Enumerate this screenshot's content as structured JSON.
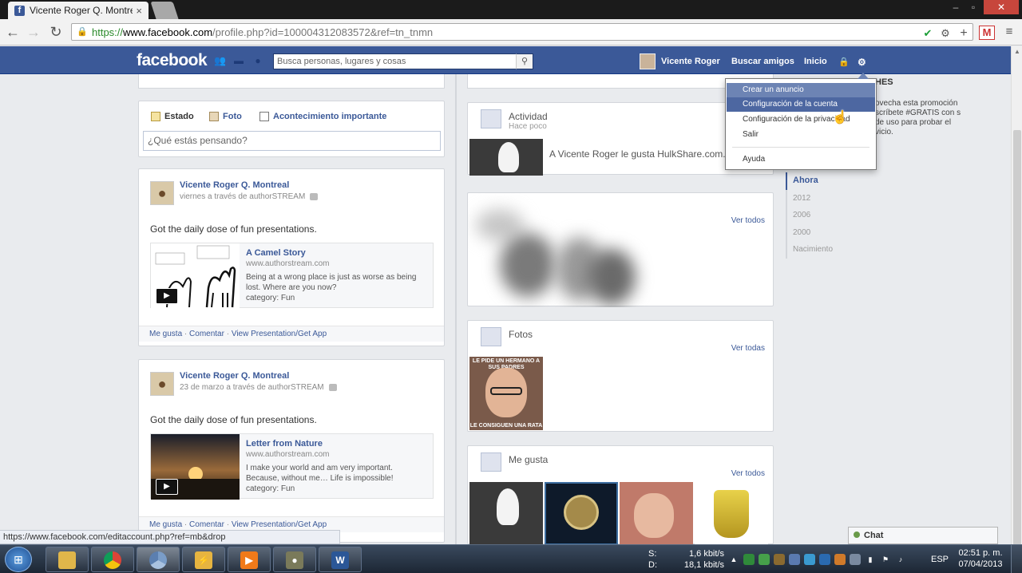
{
  "browser": {
    "tab_title": "Vicente Roger Q. Montrea",
    "url_scheme": "https://",
    "url_host": "www.facebook.com",
    "url_path": "/profile.php?id=100004312083572&ref=tn_tnmn",
    "status_url": "https://www.facebook.com/editaccount.php?ref=mb&drop"
  },
  "fbbar": {
    "logo": "facebook",
    "search_placeholder": "Busca personas, lugares y cosas",
    "profile_name": "Vicente Roger",
    "find_friends": "Buscar amigos",
    "home": "Inicio"
  },
  "composer": {
    "tab_status": "Estado",
    "tab_photo": "Foto",
    "tab_event": "Acontecimiento importante",
    "placeholder": "¿Qué estás pensando?"
  },
  "posts": [
    {
      "author": "Vicente Roger Q. Montreal",
      "meta": "viernes a través de authorSTREAM",
      "text": "Got the daily dose of fun presentations.",
      "share_title": "A Camel Story",
      "share_url": "www.authorstream.com",
      "share_desc": "Being at a wrong place is just as worse as being lost. Where are you now?",
      "share_category": "category: Fun",
      "like": "Me gusta",
      "comment": "Comentar",
      "app": "View Presentation/Get App"
    },
    {
      "author": "Vicente Roger Q. Montreal",
      "meta": "23 de marzo a través de authorSTREAM",
      "text": "Got the daily dose of fun presentations.",
      "share_title": "Letter from Nature",
      "share_url": "www.authorstream.com",
      "share_desc": "I make your world and am very important. Because, without me… Life is impossible!",
      "share_category": "category: Fun",
      "like": "Me gusta",
      "comment": "Comentar",
      "app": "View Presentation/Get App"
    }
  ],
  "activity": {
    "title": "Actividad",
    "subtitle": "Hace poco",
    "text_prefix": "A Vicente Roger le gusta ",
    "text_link": "HulkShare.com."
  },
  "friends_box": {
    "see_all": "Ver todos"
  },
  "photos": {
    "title": "Fotos",
    "see_all": "Ver todas",
    "caption_top": "LE PIDE UN HERMANO A SUS PADRES",
    "caption_bottom": "LE CONSIGUEN UNA RATA"
  },
  "likes": {
    "title": "Me gusta",
    "see_all": "Ver todos"
  },
  "sidebar": {
    "title": "HES",
    "text": "ovecha esta promoción scríbete #GRATIS con s de uso para probar el vicio.",
    "years": [
      "Ahora",
      "2012",
      "2006",
      "2000",
      "Nacimiento"
    ]
  },
  "dropdown": {
    "create_ad": "Crear un anuncio",
    "account_settings": "Configuración de la cuenta",
    "privacy_settings": "Configuración de la privacidad",
    "logout": "Salir",
    "help": "Ayuda"
  },
  "chat": {
    "label": "Chat"
  },
  "taskbar": {
    "net_send_label": "S:",
    "net_send_value": "1,6 kbit/s",
    "net_recv_label": "D:",
    "net_recv_value": "18,1 kbit/s",
    "lang": "ESP",
    "time": "02:51 p. m.",
    "date": "07/04/2013",
    "word_glyph": "W"
  }
}
